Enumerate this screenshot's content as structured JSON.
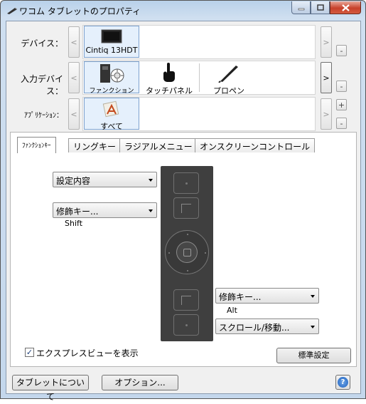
{
  "window": {
    "title": "ワコム タブレットのプロパティ"
  },
  "device_row": {
    "label": "デバイス：",
    "selected": "Cintiq 13HDT"
  },
  "input_device_row": {
    "label": "入力デバイス：",
    "items": [
      "ファンクション",
      "タッチパネル",
      "プロペン"
    ]
  },
  "application_row": {
    "label": "ｱﾌﾟﾘｹｰｼｮﾝ：",
    "selected": "すべて"
  },
  "nav": {
    "prev": "<",
    "next": ">",
    "add": "+",
    "remove": "-"
  },
  "tabs": [
    "ﾌｧﾝｸｼｮﾝｷｰ",
    "リングキー",
    "ラジアルメニュー",
    "オンスクリーンコントロール"
  ],
  "function_keys": {
    "key1_setting": "設定内容",
    "key2_setting": "修飾キー...",
    "key2_value": "Shift",
    "key3_setting": "修飾キー...",
    "key3_value": "Alt",
    "key4_setting": "スクロール/移動..."
  },
  "express_view": {
    "label": "エクスプレスビューを表示",
    "checked": true
  },
  "buttons": {
    "default": "標準設定",
    "about": "タブレットについて",
    "options": "オプション...",
    "help": "?"
  }
}
